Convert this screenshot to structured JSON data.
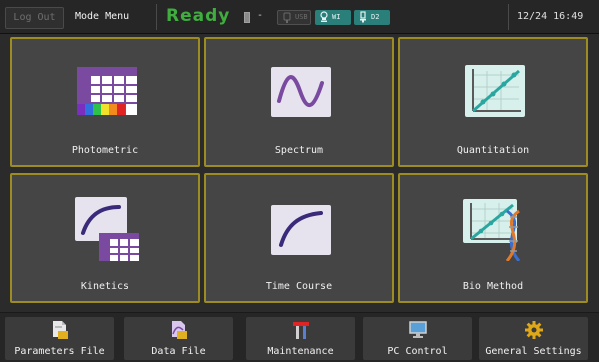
{
  "header": {
    "logout_label": "Log Out",
    "mode_label": "Mode Menu",
    "status": "Ready",
    "status_color": "#3fae3f",
    "cell_icon": "cell-holder-icon",
    "cell_value": "-",
    "usb_label": "USB",
    "usb_icon": "usb-icon",
    "lamps": [
      {
        "label": "WI",
        "icon": "lamp-icon"
      },
      {
        "label": "D2",
        "icon": "lamp-icon"
      }
    ],
    "date": "12/24",
    "time": "16:49"
  },
  "tiles": [
    {
      "label": "Photometric",
      "icon": "photometric-table-icon"
    },
    {
      "label": "Spectrum",
      "icon": "spectrum-wave-icon"
    },
    {
      "label": "Quantitation",
      "icon": "quantitation-curve-icon"
    },
    {
      "label": "Kinetics",
      "icon": "kinetics-icon"
    },
    {
      "label": "Time Course",
      "icon": "time-course-icon"
    },
    {
      "label": "Bio Method",
      "icon": "bio-method-dna-icon"
    }
  ],
  "tile_border_color": "#9c8c22",
  "footer": {
    "buttons": [
      {
        "label": "Parameters File",
        "icon": "parameters-file-icon"
      },
      {
        "label": "Data File",
        "icon": "data-file-icon"
      },
      {
        "label": "Maintenance",
        "icon": "maintenance-tools-icon"
      },
      {
        "label": "PC Control",
        "icon": "pc-monitor-icon"
      },
      {
        "label": "General Settings",
        "icon": "settings-gear-icon"
      }
    ]
  }
}
